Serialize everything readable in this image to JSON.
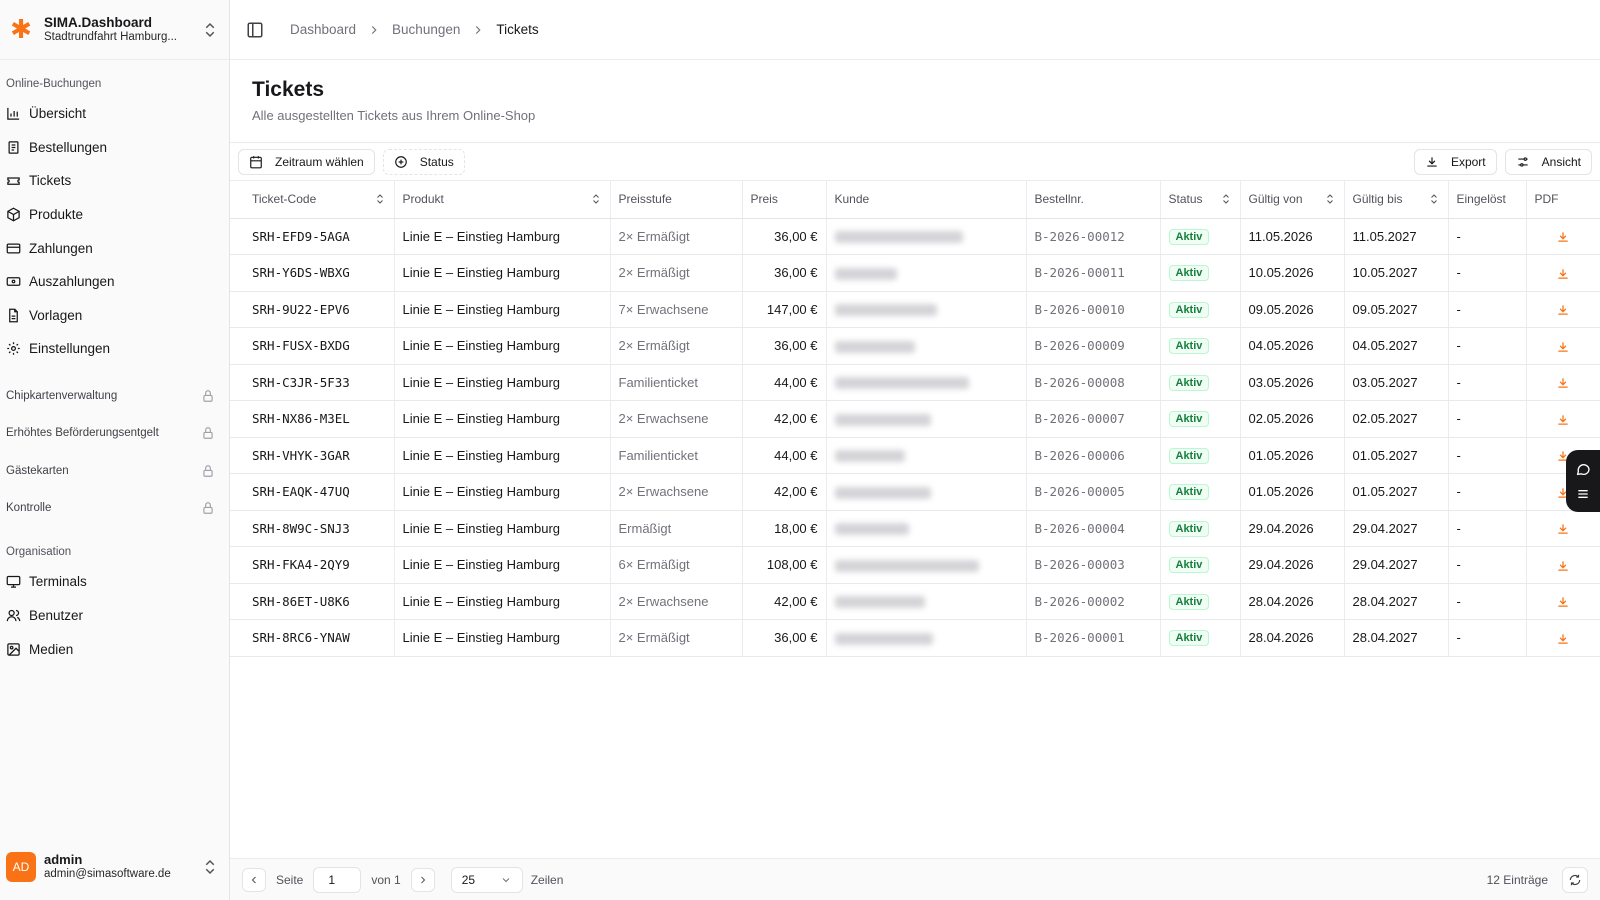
{
  "brand": {
    "title_bold": "SIMA",
    "title_rest": ".Dashboard",
    "subtitle": "Stadtrundfahrt Hamburg..."
  },
  "sidebar": {
    "group_online": "Online-Buchungen",
    "items": [
      {
        "label": "Übersicht",
        "icon": "chart-icon"
      },
      {
        "label": "Bestellungen",
        "icon": "receipt-icon"
      },
      {
        "label": "Tickets",
        "icon": "ticket-icon"
      },
      {
        "label": "Produkte",
        "icon": "package-icon"
      },
      {
        "label": "Zahlungen",
        "icon": "credit-card-icon"
      },
      {
        "label": "Auszahlungen",
        "icon": "banknote-icon"
      },
      {
        "label": "Vorlagen",
        "icon": "file-icon"
      },
      {
        "label": "Einstellungen",
        "icon": "gear-icon"
      }
    ],
    "locked": [
      "Chipkartenverwaltung",
      "Erhöhtes Beförderungsentgelt",
      "Gästekarten",
      "Kontrolle"
    ],
    "group_org": "Organisation",
    "org_items": [
      {
        "label": "Terminals",
        "icon": "monitor-icon"
      },
      {
        "label": "Benutzer",
        "icon": "users-icon"
      },
      {
        "label": "Medien",
        "icon": "image-icon"
      }
    ]
  },
  "user": {
    "initials": "AD",
    "name": "admin",
    "email": "admin@simasoftware.de"
  },
  "breadcrumb": [
    "Dashboard",
    "Buchungen",
    "Tickets"
  ],
  "page": {
    "title": "Tickets",
    "subtitle": "Alle ausgestellten Tickets aus Ihrem Online-Shop"
  },
  "toolbar": {
    "date_filter": "Zeitraum wählen",
    "status_filter": "Status",
    "export": "Export",
    "view": "Ansicht"
  },
  "table": {
    "headers": [
      "Ticket-Code",
      "Produkt",
      "Preisstufe",
      "Preis",
      "Kunde",
      "Bestellnr.",
      "Status",
      "Gültig von",
      "Gültig bis",
      "Eingelöst",
      "PDF"
    ],
    "rows": [
      {
        "code": "SRH-EFD9-5AGA",
        "product": "Linie E – Einstieg Hamburg",
        "tier": "2× Ermäßigt",
        "price": "36,00 €",
        "order": "B-2026-00012",
        "status": "Aktiv",
        "from": "11.05.2026",
        "to": "11.05.2027",
        "redeemed": "-"
      },
      {
        "code": "SRH-Y6DS-WBXG",
        "product": "Linie E – Einstieg Hamburg",
        "tier": "2× Ermäßigt",
        "price": "36,00 €",
        "order": "B-2026-00011",
        "status": "Aktiv",
        "from": "10.05.2026",
        "to": "10.05.2027",
        "redeemed": "-"
      },
      {
        "code": "SRH-9U22-EPV6",
        "product": "Linie E – Einstieg Hamburg",
        "tier": "7× Erwachsene",
        "price": "147,00 €",
        "order": "B-2026-00010",
        "status": "Aktiv",
        "from": "09.05.2026",
        "to": "09.05.2027",
        "redeemed": "-"
      },
      {
        "code": "SRH-FUSX-BXDG",
        "product": "Linie E – Einstieg Hamburg",
        "tier": "2× Ermäßigt",
        "price": "36,00 €",
        "order": "B-2026-00009",
        "status": "Aktiv",
        "from": "04.05.2026",
        "to": "04.05.2027",
        "redeemed": "-"
      },
      {
        "code": "SRH-C3JR-5F33",
        "product": "Linie E – Einstieg Hamburg",
        "tier": "Familienticket",
        "price": "44,00 €",
        "order": "B-2026-00008",
        "status": "Aktiv",
        "from": "03.05.2026",
        "to": "03.05.2027",
        "redeemed": "-"
      },
      {
        "code": "SRH-NX86-M3EL",
        "product": "Linie E – Einstieg Hamburg",
        "tier": "2× Erwachsene",
        "price": "42,00 €",
        "order": "B-2026-00007",
        "status": "Aktiv",
        "from": "02.05.2026",
        "to": "02.05.2027",
        "redeemed": "-"
      },
      {
        "code": "SRH-VHYK-3GAR",
        "product": "Linie E – Einstieg Hamburg",
        "tier": "Familienticket",
        "price": "44,00 €",
        "order": "B-2026-00006",
        "status": "Aktiv",
        "from": "01.05.2026",
        "to": "01.05.2027",
        "redeemed": "-"
      },
      {
        "code": "SRH-EAQK-47UQ",
        "product": "Linie E – Einstieg Hamburg",
        "tier": "2× Erwachsene",
        "price": "42,00 €",
        "order": "B-2026-00005",
        "status": "Aktiv",
        "from": "01.05.2026",
        "to": "01.05.2027",
        "redeemed": "-"
      },
      {
        "code": "SRH-8W9C-SNJ3",
        "product": "Linie E – Einstieg Hamburg",
        "tier": "Ermäßigt",
        "price": "18,00 €",
        "order": "B-2026-00004",
        "status": "Aktiv",
        "from": "29.04.2026",
        "to": "29.04.2027",
        "redeemed": "-"
      },
      {
        "code": "SRH-FKA4-2QY9",
        "product": "Linie E – Einstieg Hamburg",
        "tier": "6× Ermäßigt",
        "price": "108,00 €",
        "order": "B-2026-00003",
        "status": "Aktiv",
        "from": "29.04.2026",
        "to": "29.04.2027",
        "redeemed": "-"
      },
      {
        "code": "SRH-86ET-U8K6",
        "product": "Linie E – Einstieg Hamburg",
        "tier": "2× Erwachsene",
        "price": "42,00 €",
        "order": "B-2026-00002",
        "status": "Aktiv",
        "from": "28.04.2026",
        "to": "28.04.2027",
        "redeemed": "-"
      },
      {
        "code": "SRH-8RC6-YNAW",
        "product": "Linie E – Einstieg Hamburg",
        "tier": "2× Ermäßigt",
        "price": "36,00 €",
        "order": "B-2026-00001",
        "status": "Aktiv",
        "from": "28.04.2026",
        "to": "28.04.2027",
        "redeemed": "-"
      }
    ]
  },
  "pagination": {
    "page_label": "Seite",
    "page_value": "1",
    "of_label": "von 1",
    "rows_value": "25",
    "rows_label": "Zeilen",
    "total": "12 Einträge"
  },
  "colors": {
    "accent": "#f97316",
    "success": "#15803d"
  }
}
